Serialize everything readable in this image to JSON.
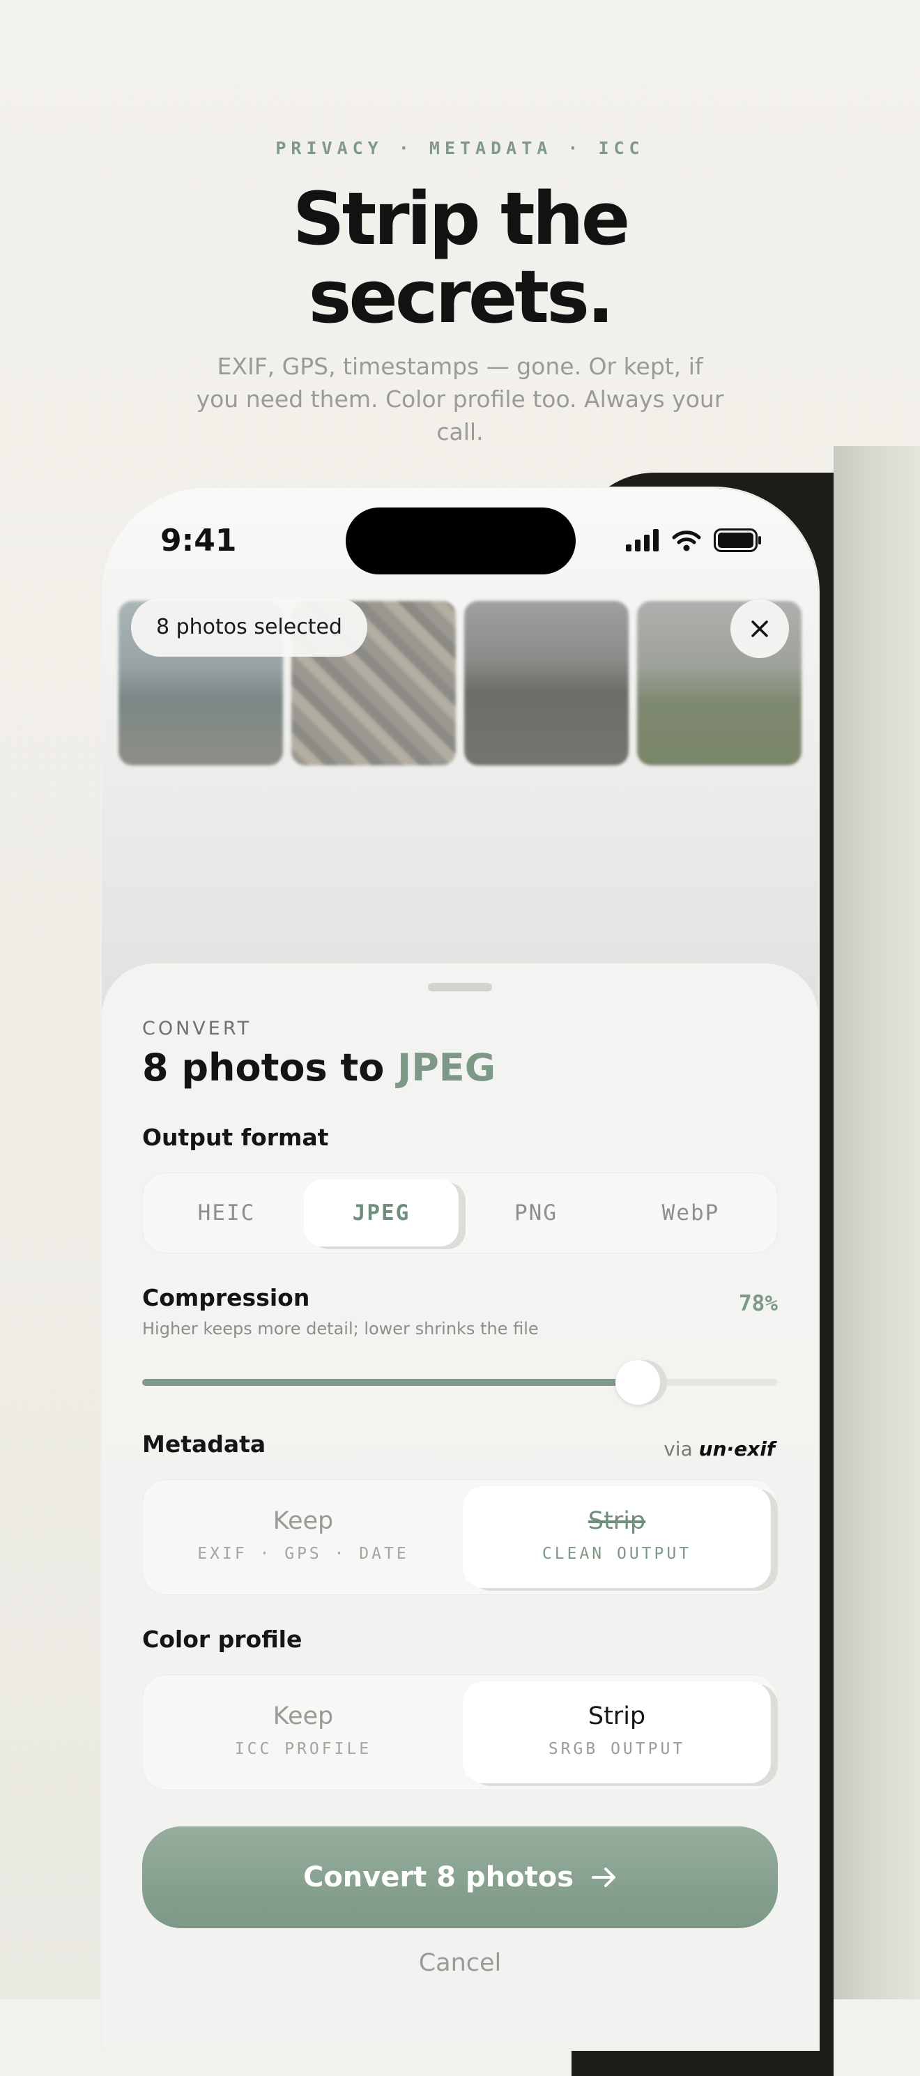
{
  "promo": {
    "eyebrow": "PRIVACY · METADATA · ICC",
    "headline_line1": "Strip the",
    "headline_line2": "secrets.",
    "subtitle": "EXIF, GPS, timestamps — gone. Or kept, if you need them. Color profile too. Always your call."
  },
  "status_bar": {
    "time": "9:41"
  },
  "selection": {
    "label": "8 photos selected"
  },
  "sheet": {
    "eyebrow": "CONVERT",
    "title_prefix": "8 photos to ",
    "title_format": "JPEG",
    "output_format": {
      "label": "Output format",
      "options": [
        "HEIC",
        "JPEG",
        "PNG",
        "WebP"
      ],
      "selected": "JPEG"
    },
    "compression": {
      "label": "Compression",
      "value_label": "78%",
      "value": 0.78,
      "hint": "Higher keeps more detail; lower shrinks the file"
    },
    "metadata": {
      "label": "Metadata",
      "via_prefix": "via",
      "via_brand": "un·exif",
      "keep_label": "Keep",
      "keep_sub": "EXIF · GPS · DATE",
      "strip_label": "Strip",
      "strip_sub": "CLEAN OUTPUT",
      "selected": "Strip"
    },
    "color_profile": {
      "label": "Color profile",
      "keep_label": "Keep",
      "keep_sub": "ICC PROFILE",
      "strip_label": "Strip",
      "strip_sub": "SRGB OUTPUT",
      "selected": "Strip"
    },
    "cta_label": "Convert 8 photos",
    "cancel_label": "Cancel"
  },
  "colors": {
    "accent": "#7d9986",
    "background": "#f3f1eb",
    "text": "#141414"
  },
  "icons": [
    "signal-icon",
    "wifi-icon",
    "battery-icon",
    "close-icon",
    "arrow-right-icon"
  ]
}
